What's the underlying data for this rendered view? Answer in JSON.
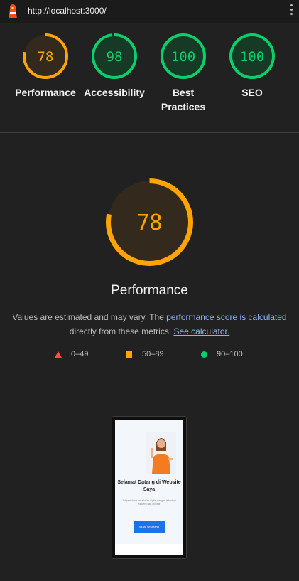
{
  "topbar": {
    "url": "http://localhost:3000/"
  },
  "summary": [
    {
      "score": "78",
      "label": "Performance",
      "fraction": 0.78,
      "status": "average"
    },
    {
      "score": "98",
      "label": "Accessibility",
      "fraction": 0.98,
      "status": "pass"
    },
    {
      "score": "100",
      "label": "Best Practices",
      "fraction": 1.0,
      "status": "pass"
    },
    {
      "score": "100",
      "label": "SEO",
      "fraction": 1.0,
      "status": "pass"
    }
  ],
  "main": {
    "score": "78",
    "fraction": 0.78,
    "title": "Performance",
    "desc_prefix": "Values are estimated and may vary. The ",
    "link1": "performance score is calculated",
    "desc_mid": " directly from these metrics.",
    "link2": "See calculator."
  },
  "legend": {
    "fail": "0–49",
    "average": "50–89",
    "pass": "90–100"
  },
  "thumbnail": {
    "heading": "Selamat Datang di Website Saya",
    "paragraph": "Jelajahi dunia kreativitas digital dengan teknologi modern dan inovatif",
    "button": "Mulai Sekarang"
  },
  "colors": {
    "average": "#ffa400",
    "average_bg": "#33291c",
    "pass": "#0cce6b",
    "pass_bg": "#173a26",
    "fail": "#ff4e42"
  }
}
